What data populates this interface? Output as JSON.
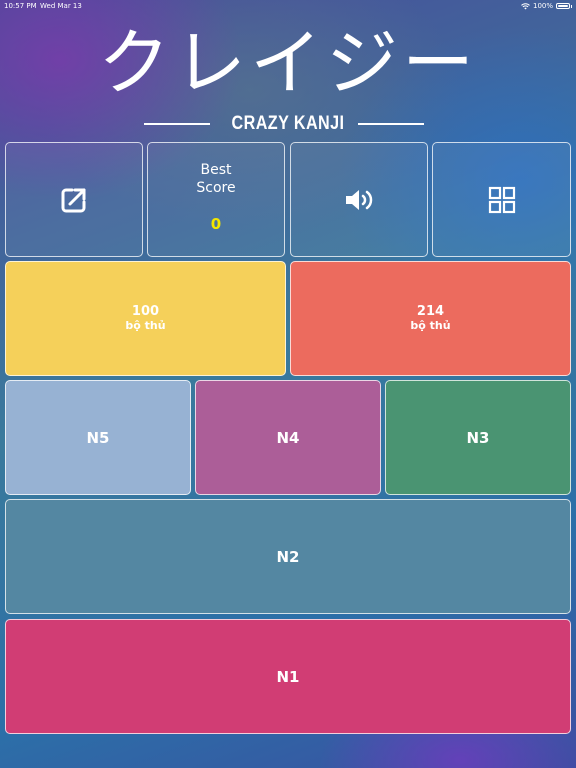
{
  "status_bar": {
    "time": "10:57 PM",
    "date": "Wed Mar 13",
    "battery": "100%"
  },
  "header": {
    "title": "クレイジー",
    "subtitle": "CRAZY KANJI"
  },
  "toolbar": {
    "share_icon": "share-external-icon",
    "best_score_label_line1": "Best",
    "best_score_label_line2": "Score",
    "best_score_value": "0",
    "sound_icon": "speaker-icon",
    "apps_icon": "grid-icon"
  },
  "radicals": [
    {
      "count": "100",
      "label": "bộ thủ",
      "color": "#f5d05a"
    },
    {
      "count": "214",
      "label": "bộ thủ",
      "color": "#ec6b5e"
    }
  ],
  "levels": [
    {
      "label": "N5",
      "color": "#97b2d3"
    },
    {
      "label": "N4",
      "color": "#ac5e98"
    },
    {
      "label": "N3",
      "color": "#4a9472"
    },
    {
      "label": "N2",
      "color": "#5487a2"
    },
    {
      "label": "N1",
      "color": "#d13d74"
    }
  ],
  "colors": {
    "best_score_value": "#f3e600",
    "tile_border": "#ffffff"
  }
}
